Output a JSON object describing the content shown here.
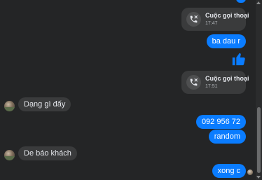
{
  "messages": {
    "call_1": {
      "title": "Cuộc gọi thoại",
      "time": "17:47"
    },
    "out_1": "ba dau r",
    "call_2": {
      "title": "Cuộc gọi thoại",
      "time": "17:51"
    },
    "in_1": "Dạng gì đấy",
    "out_2": "092 956 72",
    "out_3": "random",
    "in_2": "De báo khách",
    "out_4": "xong c"
  },
  "colors": {
    "outgoing_bubble": "#0a7cff",
    "incoming_bubble": "#3a3b3c",
    "background": "#242526"
  },
  "icons": [
    "phone-missed-icon",
    "thumbs-up-icon",
    "avatar",
    "seen-avatar"
  ]
}
